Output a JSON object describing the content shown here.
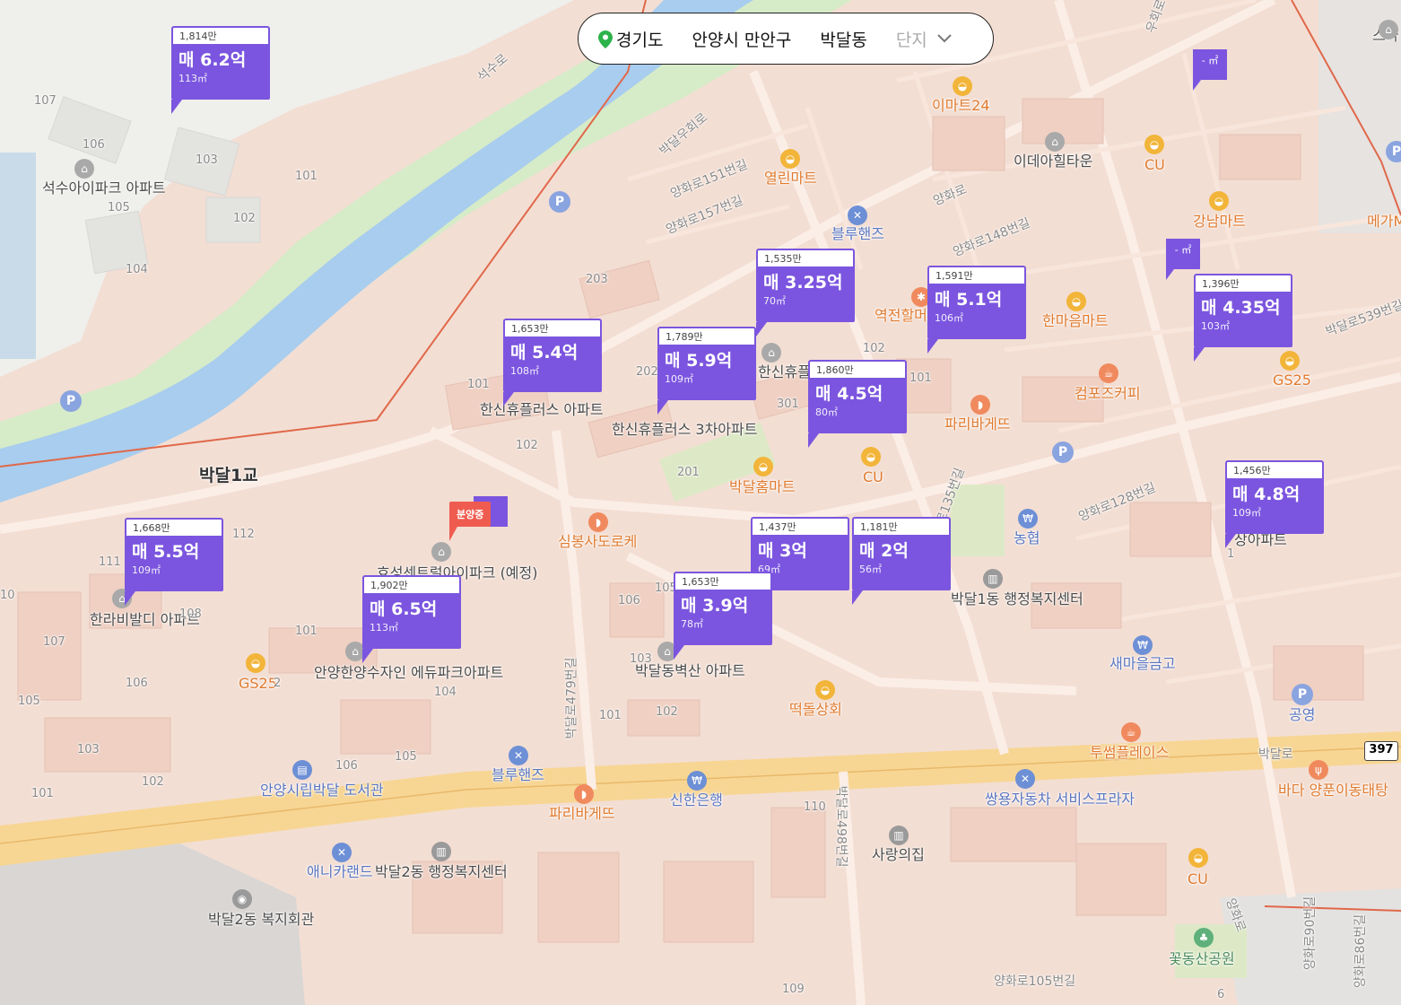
{
  "breadcrumb": {
    "province": "경기도",
    "city": "안양시 만안구",
    "dong": "박달동",
    "type": "단지"
  },
  "listings": [
    {
      "unit_price": "1,814만",
      "price": "매 6.2억",
      "area": "113㎡"
    },
    {
      "unit_price": "1,535만",
      "price": "매 3.25억",
      "area": "70㎡"
    },
    {
      "unit_price": "1,591만",
      "price": "매 5.1억",
      "area": "106㎡"
    },
    {
      "unit_price": "1,396만",
      "price": "매 4.35억",
      "area": "103㎡"
    },
    {
      "unit_price": "1,653만",
      "price": "매 5.4억",
      "area": "108㎡"
    },
    {
      "unit_price": "1,789만",
      "price": "매 5.9억",
      "area": "109㎡"
    },
    {
      "unit_price": "1,860만",
      "price": "매 4.5억",
      "area": "80㎡"
    },
    {
      "unit_price": "1,456만",
      "price": "매 4.8억",
      "area": "109㎡"
    },
    {
      "unit_price": "1,668만",
      "price": "매 5.5억",
      "area": "109㎡"
    },
    {
      "unit_price": "1,902만",
      "price": "매 6.5억",
      "area": "113㎡"
    },
    {
      "unit_price": "1,437만",
      "price": "매 3억",
      "area": "69㎡"
    },
    {
      "unit_price": "1,181만",
      "price": "매 2억",
      "area": "56㎡"
    },
    {
      "unit_price": "1,653만",
      "price": "매 3.9억",
      "area": "78㎡"
    }
  ],
  "mini_markers": [
    "- ㎡",
    "- ㎡"
  ],
  "sale_tag": "분양중",
  "route_shield": "397",
  "places": [
    "석수아이파크 아파트",
    "이마트24",
    "열린마트",
    "이데아힐타운",
    "CU",
    "강남마트",
    "메가M",
    "블루핸즈",
    "역전할머",
    "한마음마트",
    "GS25",
    "컴포즈커피",
    "파리바게뜨",
    "CU",
    "박달홈마트",
    "한신휴플러스 아파트",
    "한신휴플러스 3차아파트",
    "한신휴플러스 아파트",
    "심봉사도로케",
    "농협",
    "박달1동 행정복지센터",
    "새마을금고",
    "한라비발디 아파트",
    "효성센트럴아이파크 (예정)",
    "안양한양수자인 에듀파크아파트",
    "박달동벽산 아파트",
    "떡돌상회",
    "투썸플레이스",
    "공영",
    "바다 양푼이동태탕",
    "GS25",
    "블루핸즈",
    "파리바게뜨",
    "신한은행",
    "쌍용자동차 서비스프라자",
    "사랑의집",
    "안양시립박달 도서관",
    "애니카랜드",
    "박달2동 행정복지센터",
    "박달2동 복지회관",
    "CU",
    "꽃동산공원",
    "스카",
    "박달1교",
    "상아파트"
  ],
  "roads": [
    "석수로",
    "박달우회로",
    "양화로151번길",
    "양화로157번길",
    "양화로",
    "양화로148번길",
    "박달로539번길",
    "양화로128번길",
    "박달로135번길",
    "박달로479번길",
    "박달로498번길",
    "박달로",
    "양화로105번길",
    "양화로90번길",
    "양화로86번길",
    "우회로",
    "양화로"
  ],
  "building_numbers": [
    "107",
    "106",
    "103",
    "101",
    "102",
    "104",
    "105",
    "203",
    "202",
    "201",
    "101",
    "102",
    "301",
    "102",
    "101",
    "112",
    "111",
    "108",
    "107",
    "106",
    "105",
    "103",
    "102",
    "101",
    "104",
    "105",
    "106",
    "101",
    "103",
    "102",
    "105",
    "106",
    "110",
    "109",
    "101",
    "10",
    "6",
    "2",
    "1"
  ]
}
